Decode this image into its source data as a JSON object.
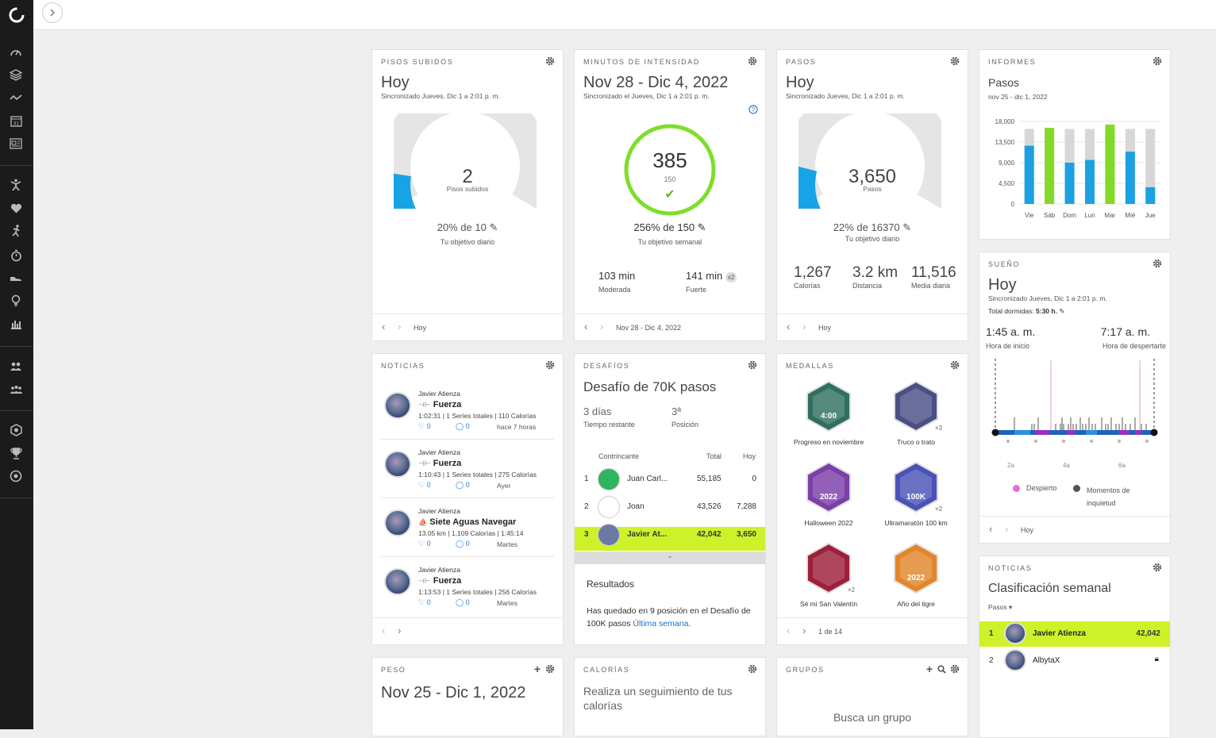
{
  "sidebar": {
    "items": [
      "dashboard-icon",
      "layers-icon",
      "activity-line-icon",
      "calendar-icon",
      "news-icon",
      "activity-person-icon",
      "heart-icon",
      "running-icon",
      "stopwatch-icon",
      "shoe-icon",
      "lightbulb-icon",
      "bar-chart-icon",
      "group-icon",
      "groups-icon",
      "badge-icon",
      "trophy-icon",
      "target-icon"
    ],
    "calendar_day": "31"
  },
  "floors": {
    "title": "PISOS SUBIDOS",
    "period": "Hoy",
    "sync": "Sincronizado Jueves, Dic 1 a 2:01 p. m.",
    "value": "2",
    "unit": "Pisos subidos",
    "percent_text": "20% de 10",
    "goal_label": "Tu objetivo diario",
    "progress": 0.2,
    "footer": "Hoy"
  },
  "intensity": {
    "title": "MINUTOS DE INTENSIDAD",
    "period": "Nov 28 - Dic 4, 2022",
    "sync": "Sincronizado el Jueves, Dic 1 a 2:01 p. m.",
    "value": "385",
    "target": "150",
    "percent_text": "256% de 150",
    "goal_label": "Tu objetivo semanal",
    "moderate_value": "103 min",
    "moderate_label": "Moderada",
    "vigorous_value": "141 min",
    "vigorous_mult": "x2",
    "vigorous_label": "Fuerte",
    "footer": "Nov 28 - Dic 4, 2022"
  },
  "steps": {
    "title": "PASOS",
    "period": "Hoy",
    "sync": "Sincronizado Jueves, Dic 1 a 2:01 p. m.",
    "value": "3,650",
    "unit": "Pasos",
    "percent_text": "22% de 16370",
    "goal_label": "Tu objetivo diario",
    "progress": 0.22,
    "calories_value": "1,267",
    "calories_label": "Calorías",
    "distance_value": "3.2 km",
    "distance_label": "Distancia",
    "avg_value": "11,516",
    "avg_label": "Media diaria",
    "footer": "Hoy"
  },
  "reports": {
    "title": "INFORMES",
    "subtitle": "Pasos",
    "range": "nov 25 - dic 1, 2022"
  },
  "chart_data": {
    "type": "bar",
    "categories": [
      "Vie",
      "Sáb",
      "Dom",
      "Lun",
      "Mar",
      "Mié",
      "Jue"
    ],
    "values": [
      12700,
      16600,
      9000,
      9600,
      17300,
      11400,
      3650
    ],
    "goals": [
      16370,
      16370,
      16370,
      16370,
      16370,
      16370,
      16370
    ],
    "goal_met": [
      false,
      true,
      false,
      false,
      true,
      false,
      false
    ],
    "yticks": [
      "18,000",
      "13,500",
      "9,000",
      "4,500",
      "0"
    ],
    "ylim": [
      0,
      18000
    ],
    "colors": {
      "met": "#82da26",
      "unmet": "#1ba1e2",
      "remaining": "#d7d7d7"
    }
  },
  "sleep": {
    "title": "SUEÑO",
    "period": "Hoy",
    "sync": "Sincronizado Jueves, Dic 1 a 2:01 p. m.",
    "total_label": "Total dormidas:",
    "total_value": "5:30 h.",
    "start_time": "1:45 a. m.",
    "start_label": "Hora de inicio",
    "wake_time": "7:17 a. m.",
    "wake_label": "Hora de despertarte",
    "axis": [
      "2a",
      "4a",
      "6a"
    ],
    "legend_awake": "Despierto",
    "legend_restless": "Momentos de inquietud",
    "footer": "Hoy"
  },
  "news": {
    "title": "NOTICIAS",
    "items": [
      {
        "user": "Javier Atienza",
        "activity": "Fuerza",
        "stats": "1:02:31 | 1 Series totales | 110 Calorías",
        "likes": "0",
        "comments": "0",
        "time": "hace 7 horas"
      },
      {
        "user": "Javier Atienza",
        "activity": "Fuerza",
        "stats": "1:10:43 | 1 Series totales | 275 Calorías",
        "likes": "0",
        "comments": "0",
        "time": "Ayer"
      },
      {
        "user": "Javier Atienza",
        "activity": "Siete Aguas Navegar",
        "stats": "13.05 km | 1,109 Calorías | 1:45:14",
        "likes": "0",
        "comments": "0",
        "time": "Martes"
      },
      {
        "user": "Javier Atienza",
        "activity": "Fuerza",
        "stats": "1:13:53 | 1 Series totales | 256 Calorías",
        "likes": "0",
        "comments": "0",
        "time": "Martes"
      }
    ]
  },
  "challenges": {
    "title": "DESAFÍOS",
    "name": "Desafío de 70K pasos",
    "days_value": "3 días",
    "days_label": "Tiempo restante",
    "pos_value": "3ª",
    "pos_label": "Posición",
    "col_rival": "Contrincante",
    "col_total": "Total",
    "col_today": "Hoy",
    "rows": [
      {
        "rank": "1",
        "name": "Juan Carl...",
        "total": "55,185",
        "today": "0"
      },
      {
        "rank": "2",
        "name": "Joan",
        "total": "43,526",
        "today": "7,288"
      },
      {
        "rank": "3",
        "name": "Javier At...",
        "total": "42,042",
        "today": "3,650"
      }
    ],
    "results_title": "Resultados",
    "results_text": "Has quedado en 9 posición en el Desafío de 100K pasos ",
    "results_link": "Última semana",
    "results_end": "."
  },
  "medals": {
    "title": "MEDALLAS",
    "items": [
      {
        "label": "Progreso en noviembre",
        "text": "4:00",
        "mult": ""
      },
      {
        "label": "Truco o trato",
        "text": "",
        "mult": "×3"
      },
      {
        "label": "Halloween 2022",
        "text": "2022",
        "mult": ""
      },
      {
        "label": "Ultramaratón 100 km",
        "text": "100K",
        "mult": "×2"
      },
      {
        "label": "Sé mi San Valentín",
        "text": "",
        "mult": "×2"
      },
      {
        "label": "Año del tigre",
        "text": "2022",
        "mult": ""
      }
    ],
    "pager": "1 de 14"
  },
  "leaderboard": {
    "title": "NOTICIAS",
    "name": "Clasificación semanal",
    "filter": "Pasos",
    "rows": [
      {
        "rank": "1",
        "name": "Javier Atienza",
        "value": "42,042"
      },
      {
        "rank": "2",
        "name": "AlbytaX",
        "value": ""
      }
    ]
  },
  "weight": {
    "title": "PESO",
    "period": "Nov 25 - Dic 1, 2022"
  },
  "calories": {
    "title": "CALORÍAS",
    "text": "Realiza un seguimiento de tus calorías"
  },
  "groups": {
    "title": "GRUPOS",
    "text": "Busca un grupo"
  }
}
